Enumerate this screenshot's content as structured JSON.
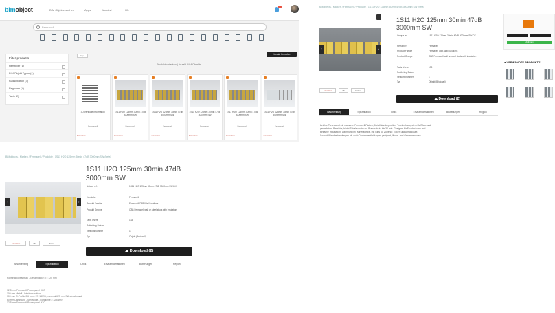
{
  "panel_a": {
    "logo_prefix": "bim",
    "logo_suffix": "object",
    "nav": [
      "BIM Objekte suchen",
      "Apps",
      "Woodis+",
      "Hilfe"
    ],
    "notif_count": "1",
    "search_placeholder": "Fermacell",
    "filter_title": "Filter products",
    "filters": [
      "Hersteller (1)",
      "BIM Objekt Typen (4)",
      "Klassifikation (3)",
      "Regionen (4)",
      "Taxis (2)"
    ],
    "toggle": "1 | 1",
    "contact_button": "Kontakt Hersteller",
    "results_label": "Produktvarianten  |  Anzahl BIM Objekte",
    "cards": [
      {
        "title": "3D Vertikale Information",
        "mfr": "Fermacell",
        "fav": "Favoriten"
      },
      {
        "title": "1S11 H2O 125mm 30min 47dB 3000mm SW",
        "mfr": "Fermacell",
        "fav": "Favoriten"
      },
      {
        "title": "1S11 H2O 125mm 30min 47dB 3000mm SW",
        "mfr": "Fermacell",
        "fav": "Favoriten"
      },
      {
        "title": "1S11 H2O 125mm 30min 47dB 3000mm SW",
        "mfr": "Fermacell",
        "fav": "Favoriten"
      },
      {
        "title": "1S11 H2O 125mm 30min 47dB 3000mm SW",
        "mfr": "Fermacell",
        "fav": "Favoriten"
      },
      {
        "title": "1S11 H2O 125mm 30min 47dB 3000mm SW",
        "mfr": "Fermacell",
        "fav": "Favoriten"
      }
    ]
  },
  "product": {
    "breadcrumb": "BIMobjects  /  Marken  /  Fermacell  /  Produkte  /  1S11 H2O 125mm 30min 47dB 3000mm SW (beta)",
    "title": "1S11 H2O 125mm 30min 47dB 3000mm SW",
    "specs": [
      {
        "label": "Unique ref.",
        "value": "1S11 H2O 125mm 30min 47dB 3000mm SW-DX"
      },
      {
        "label": "Hersteller",
        "value": "Fermacell"
      },
      {
        "label": "Produkt Familie",
        "value": "Fermacell CBB Wall Solutions"
      },
      {
        "label": "Produkt Gruppe",
        "value": "CBB Fermacell wall on steel studs with insulation"
      },
      {
        "label": "Taxis Users",
        "value": "133"
      },
      {
        "label": "Publishing Datum",
        "value": ""
      },
      {
        "label": "Versionsnummer",
        "value": "1"
      },
      {
        "label": "Typ",
        "value": "Objekt (Brickwall)"
      }
    ],
    "download": "Download (2)",
    "fav_button": "Favoriten",
    "count_button": "36",
    "share_button": "Teilen",
    "tabs": [
      "Beschreibung",
      "Spezifikation",
      "Links",
      "Ersatzinformationen",
      "Bewertungen",
      "Region"
    ],
    "description": [
      "Leichte Trennwand mit massiven Fermacell-Platten, Metallständerprofilen. Trockenbausystem für Büro- und",
      "gewerbliche Bereiche, bietet Schallschutz und Brandschutz bis 30 min. Geeignet für Feuchträume und",
      "einfache Installation, Dämmung mit Mineralwolle, mit Gips für Zubehör, Ecken und Anschlüsse.",
      "Sowohl Wandverkleidungen als auch Deckenverkleidungen geeignet, Wohn- und Gewerbebauten."
    ],
    "related_title": "VERWANDTE PRODUKTE",
    "buy_label": "Anfragen"
  },
  "panel_c": {
    "spec_heading": "Konstruktionsaufbau - Gesamtdicke d = 125 mm",
    "spec_lines": [
      "12,5 mm Fermacell Powerpanel H2O",
      "100 mm Metall-Unterkonstruktion",
      "100 mm C-Profile 0,6 mm - EN 14195, maximal 625 mm Ständerabstand",
      "60 mm Dämmung - Steinwolle - Rohdichte ≥ 32 kg/m³",
      "12,5 mm Fermacell Powerpanel H2O"
    ]
  },
  "colors": {
    "brand": "#1aa3c8",
    "accent_orange": "#e8790c",
    "dark_button": "#1e1e1e",
    "green": "#3bb54a"
  }
}
